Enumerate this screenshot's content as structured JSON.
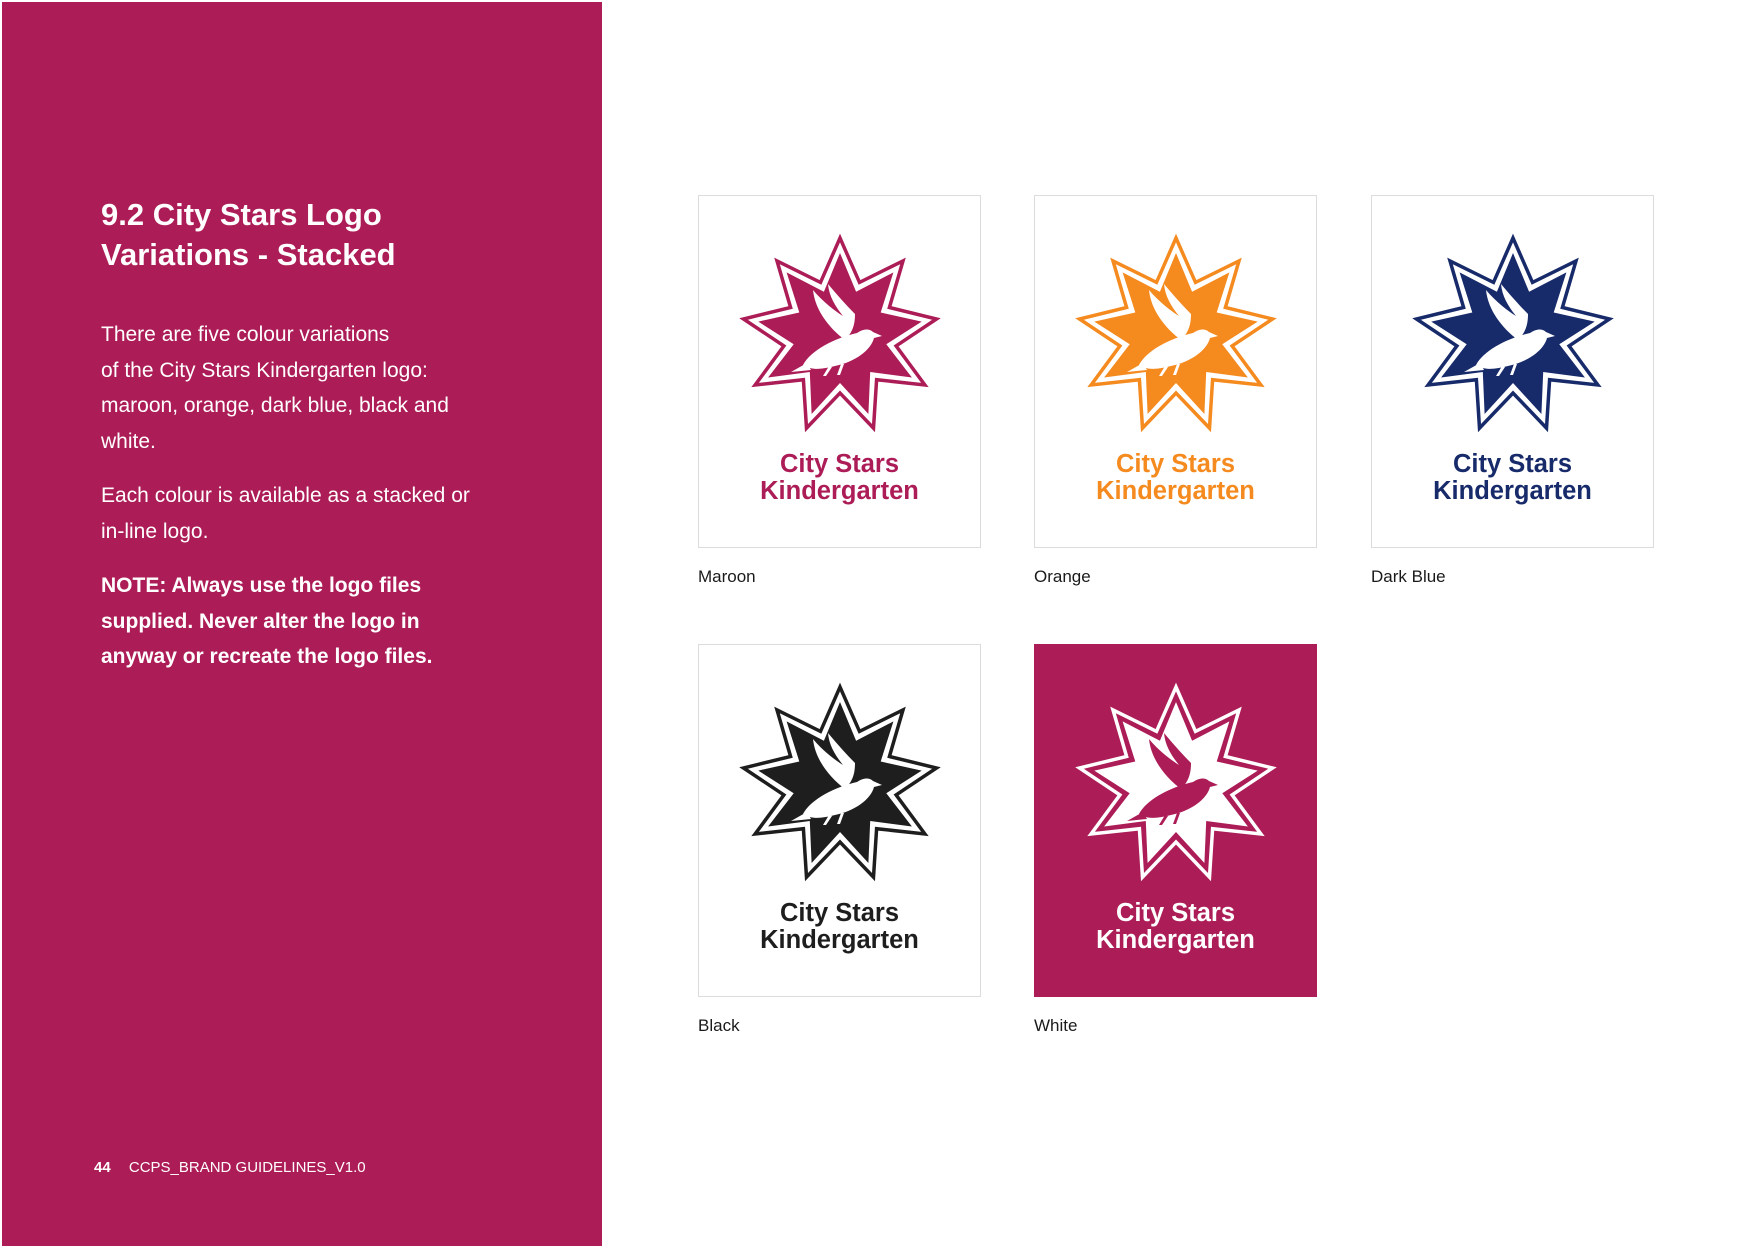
{
  "sidebar": {
    "title_lines": [
      "9.2  City Stars Logo",
      "Variations - Stacked"
    ],
    "paragraph1_lines": [
      "There are five colour variations",
      "of the City Stars Kindergarten logo:",
      "maroon, orange, dark blue, black and",
      "white."
    ],
    "paragraph2_lines": [
      "Each colour is available as a stacked or",
      "in-line logo."
    ],
    "note_lines": [
      "NOTE: Always use the logo files",
      "supplied. Never alter the logo in",
      "anyway or recreate the logo files."
    ],
    "page_number": "44",
    "document_name": "CCPS_BRAND GUIDELINES_V1.0"
  },
  "logo_text": [
    "City Stars",
    "Kindergarten"
  ],
  "variations": [
    {
      "key": "maroon",
      "caption": "Maroon",
      "color": "#ac1c56",
      "background": "#ffffff",
      "bird": "#ffffff",
      "text": "#ac1c56"
    },
    {
      "key": "orange",
      "caption": "Orange",
      "color": "#f58a1f",
      "background": "#ffffff",
      "bird": "#ffffff",
      "text": "#f58a1f"
    },
    {
      "key": "dark_blue",
      "caption": "Dark Blue",
      "color": "#172a6a",
      "background": "#ffffff",
      "bird": "#ffffff",
      "text": "#172a6a"
    },
    {
      "key": "black",
      "caption": "Black",
      "color": "#1e1e1e",
      "background": "#ffffff",
      "bird": "#ffffff",
      "text": "#1e1e1e"
    },
    {
      "key": "white",
      "caption": "White",
      "color": "#ffffff",
      "background": "#ac1c56",
      "bird": "#ac1c56",
      "text": "#ffffff"
    }
  ],
  "colors": {
    "sidebar_background": "#ac1c56",
    "card_border": "#dcdcdc"
  }
}
